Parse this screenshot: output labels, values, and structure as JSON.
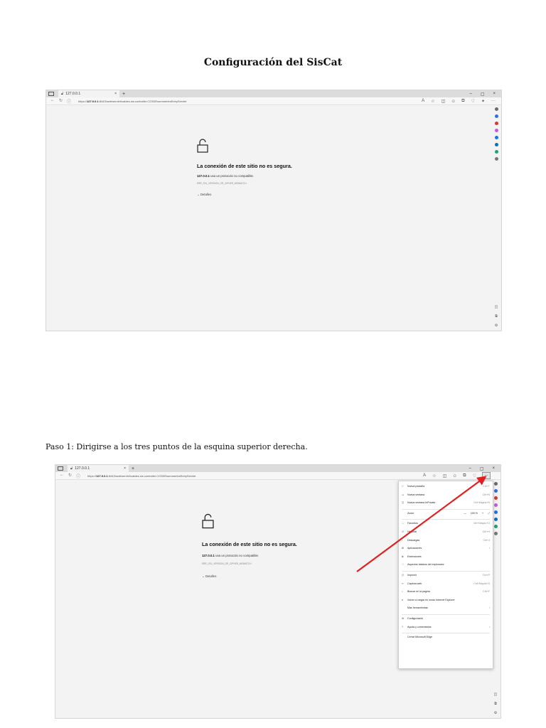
{
  "document": {
    "title": "Configuración del SisCat",
    "step_1": "Paso 1: Dirigirse a los tres puntos de la esquina superior derecha."
  },
  "browser": {
    "tab_title_1": "127.0.0.1",
    "tab_title_2": "127.0.0.1",
    "tab_close": "×",
    "new_tab": "+",
    "window_controls": {
      "minimize": "–",
      "maximize": "▢",
      "close": "×"
    },
    "nav": {
      "back": "←",
      "refresh": "↻",
      "info": "ⓘ"
    },
    "url_prefix": "https://",
    "url_host": "127.0.0.1",
    "url_path": ":8443/swb/servlet/catdes.sis.controller.CO3DEsummeriesEntryServlet",
    "toolbar_icons": [
      "read-aloud-icon",
      "favorite-star-icon",
      "split-screen-icon",
      "favorites-icon",
      "collections-icon",
      "browser-essentials-icon",
      "extensions-icon",
      "more-icon"
    ],
    "more_button": "···",
    "sidebar_icons": [
      {
        "name": "search-icon",
        "color": "#6a6a6a"
      },
      {
        "name": "shopping-icon",
        "color": "#2f6ee0"
      },
      {
        "name": "tools-icon",
        "color": "#d23a2f"
      },
      {
        "name": "games-icon",
        "color": "#c15bd8"
      },
      {
        "name": "microsoft365-icon",
        "color": "#1a73e8"
      },
      {
        "name": "outlook-icon",
        "color": "#0f6cbd"
      },
      {
        "name": "drop-icon",
        "color": "#22a06b"
      },
      {
        "name": "add-icon",
        "color": "#777777"
      }
    ],
    "sidebar_bottom_icons": [
      "hide-sidebar-icon",
      "external-link-icon",
      "settings-icon"
    ]
  },
  "error_page": {
    "heading": "La conexión de este sitio no es segura.",
    "sub_host": "127.0.0.1",
    "sub_text": "usa un protocolo no compatible.",
    "code": "ERR_SSL_VERSION_OR_CIPHER_MISMATCH",
    "details": "Detalles",
    "details_chevron": "⌄"
  },
  "menu": {
    "items": [
      {
        "label": "Nueva pestaña",
        "shortcut": "Ctrl+T",
        "icon": "□"
      },
      {
        "label": "Nueva ventana",
        "shortcut": "Ctrl+N",
        "icon": "▭"
      },
      {
        "label": "Nueva ventana InPrivate",
        "shortcut": "Ctrl+Mayús+N",
        "icon": "◫"
      },
      {
        "label": "Zoom",
        "shortcut": "",
        "icon": ""
      },
      {
        "label": "Favoritos",
        "shortcut": "Ctrl+Mayús+O",
        "icon": "☆"
      },
      {
        "label": "Historial",
        "shortcut": "Ctrl+H",
        "icon": "↺"
      },
      {
        "label": "Descargas",
        "shortcut": "Ctrl+J",
        "icon": "↓"
      },
      {
        "label": "Aplicaciones",
        "shortcut": "",
        "icon": "⊞",
        "submenu": true
      },
      {
        "label": "Extensiones",
        "shortcut": "",
        "icon": "⧉"
      },
      {
        "label": "Aspectos básicos del explorador",
        "shortcut": "",
        "icon": "♡"
      },
      {
        "label": "Imprimir",
        "shortcut": "Ctrl+P",
        "icon": "⎙"
      },
      {
        "label": "Captura web",
        "shortcut": "Ctrl+Mayús+S",
        "icon": "✂"
      },
      {
        "label": "Buscar en la página",
        "shortcut": "Ctrl+F",
        "icon": "⌕"
      },
      {
        "label": "Volver a cargar en modo Internet Explorer",
        "shortcut": "",
        "icon": "e"
      },
      {
        "label": "Más herramientas",
        "shortcut": "",
        "icon": "",
        "submenu": true
      },
      {
        "label": "Configuración",
        "shortcut": "",
        "icon": "⚙"
      },
      {
        "label": "Ayuda y comentarios",
        "shortcut": "",
        "icon": "?",
        "submenu": true
      },
      {
        "label": "Cerrar Microsoft Edge",
        "shortcut": "",
        "icon": ""
      }
    ],
    "zoom": {
      "minus": "—",
      "value": "100 %",
      "plus": "+",
      "fullscreen": "⤢"
    },
    "submenu_arrow": "›"
  },
  "annotation": {
    "arrow_color": "#e02020"
  }
}
